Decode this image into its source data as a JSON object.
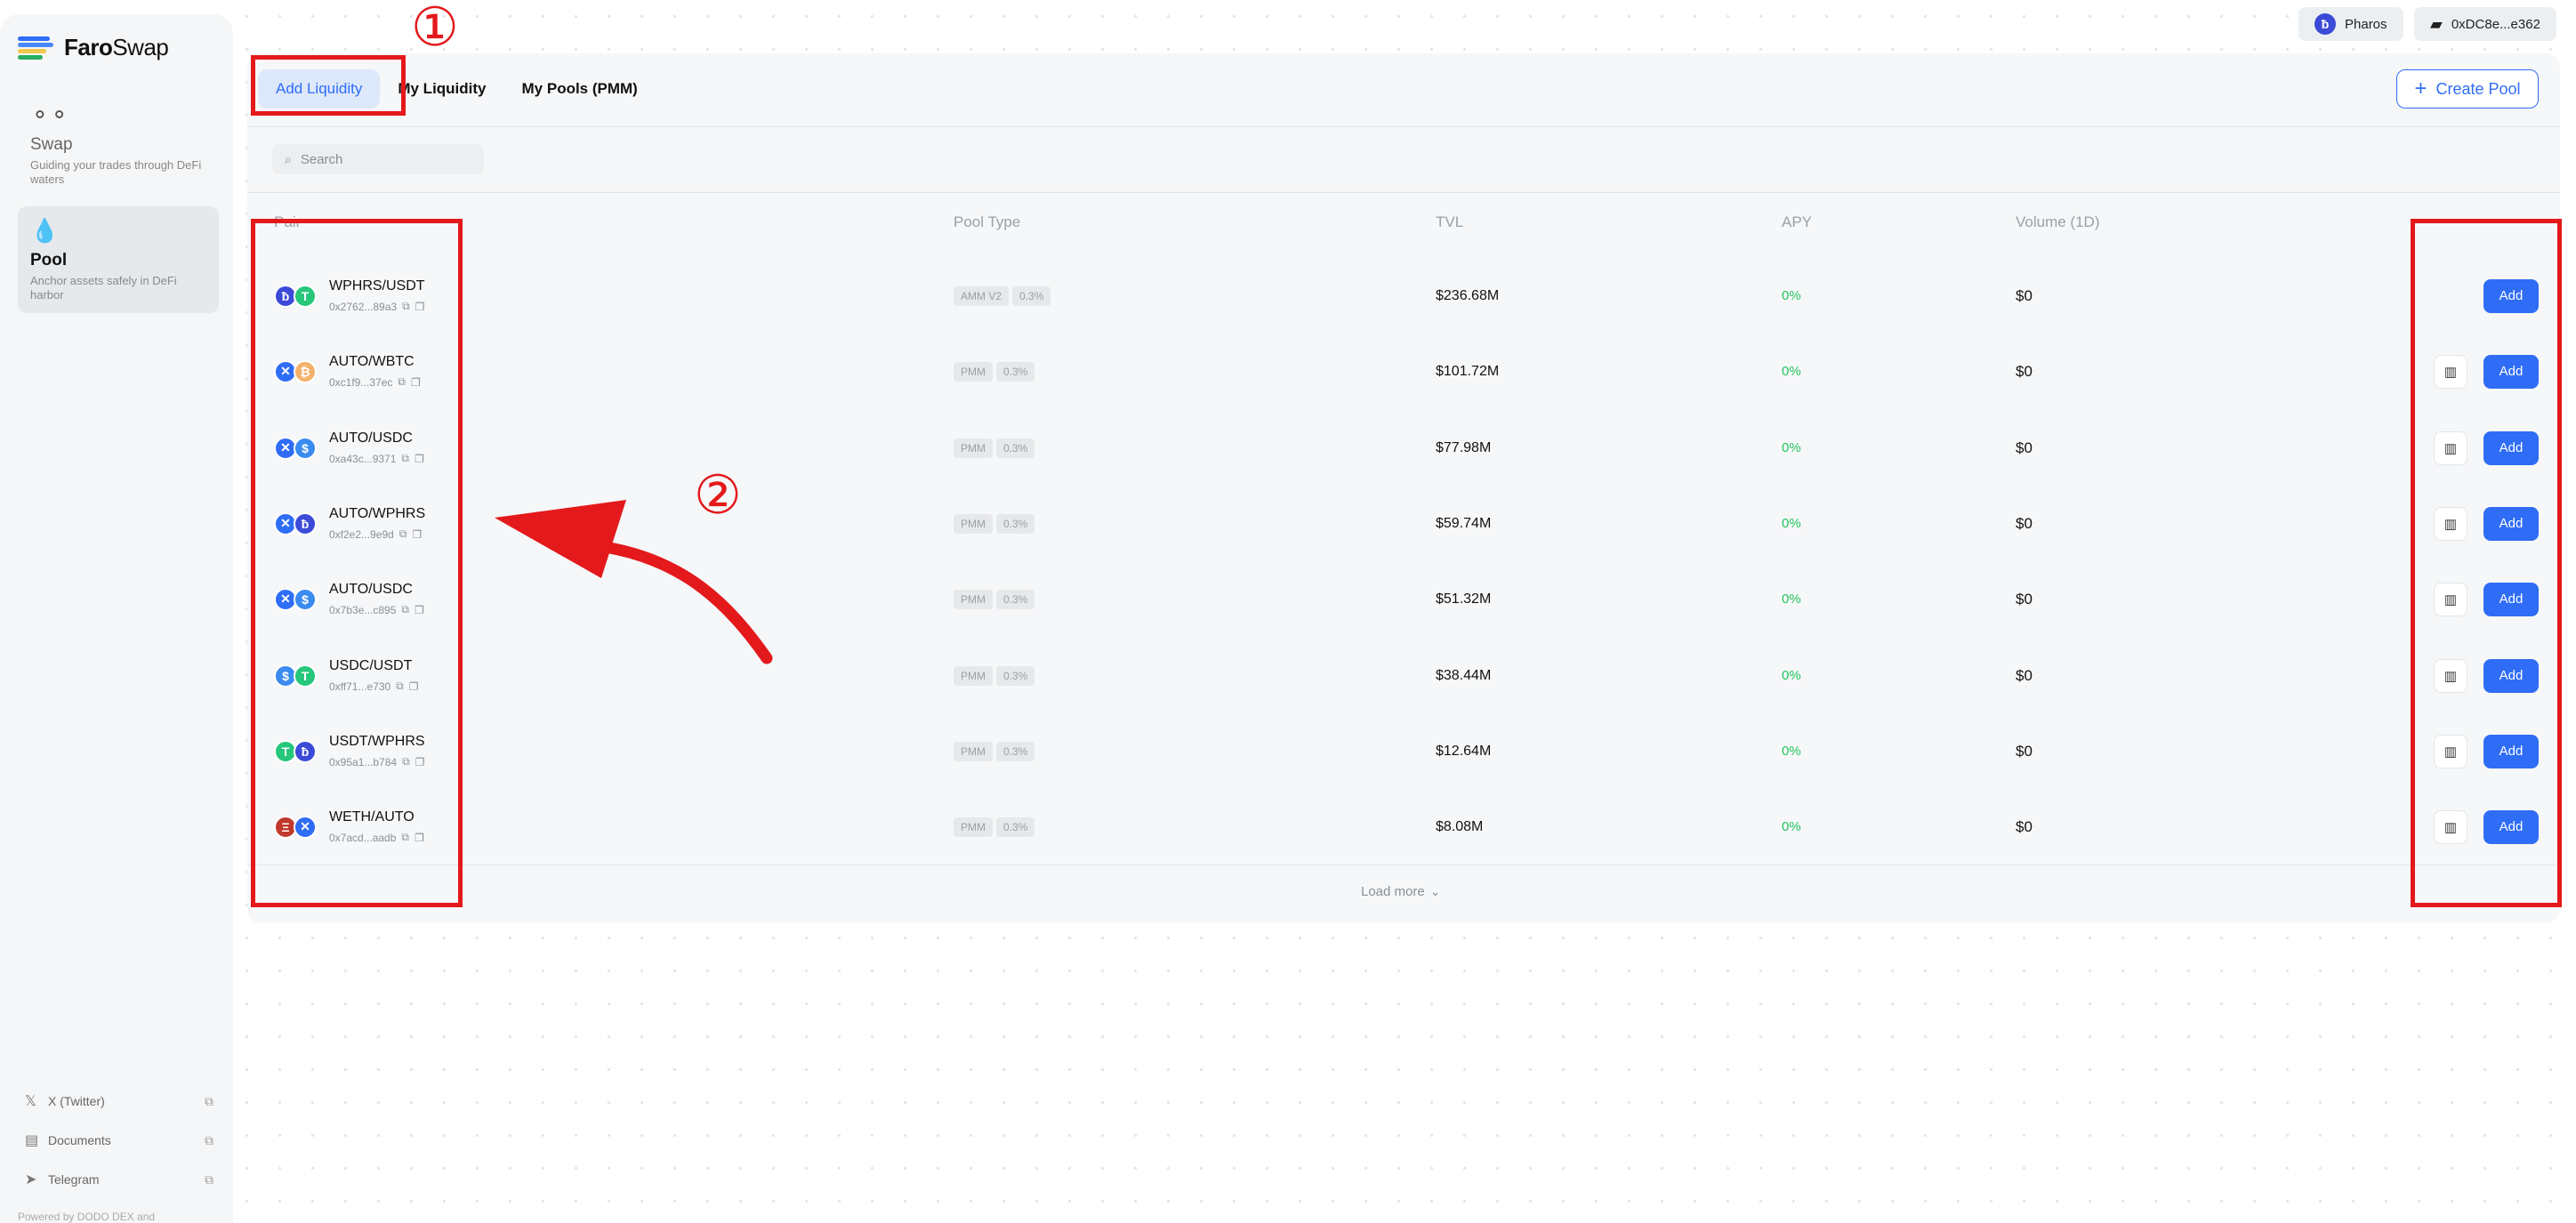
{
  "app": {
    "logo_bold": "Faro",
    "logo_rest": "Swap",
    "powered_by": "Powered by DODO DEX and"
  },
  "sidebar": {
    "items": [
      {
        "icon": "swap-icon",
        "title": "Swap",
        "desc": "Guiding your trades through DeFi waters",
        "active": false
      },
      {
        "icon": "pool-icon",
        "title": "Pool",
        "desc": "Anchor assets safely in DeFi harbor",
        "active": true
      }
    ],
    "links": [
      {
        "icon": "x-twitter-icon",
        "glyph": "𝕏",
        "label": "X (Twitter)"
      },
      {
        "icon": "documents-icon",
        "glyph": "▤",
        "label": "Documents"
      },
      {
        "icon": "telegram-icon",
        "glyph": "➤",
        "label": "Telegram"
      }
    ]
  },
  "header": {
    "network_label": "Pharos",
    "wallet_address": "0xDC8e...e362"
  },
  "tabs": [
    "Add Liquidity",
    "My Liquidity",
    "My Pools (PMM)"
  ],
  "create_pool_label": "Create Pool",
  "search_placeholder": "Search",
  "columns": {
    "pair": "Pair",
    "pool_type": "Pool Type",
    "tvl": "TVL",
    "apy": "APY",
    "volume": "Volume (1D)"
  },
  "add_label": "Add",
  "load_more_label": "Load more",
  "colors": {
    "accent": "#2f6df6",
    "apy_green": "#22c55e",
    "annotation_red": "#e3191b"
  },
  "pools": [
    {
      "pair": "WPHRS/USDT",
      "address": "0x2762...89a3",
      "type": "AMM V2",
      "fee": "0.3%",
      "tvl": "$236.68M",
      "apy": "0%",
      "volume": "$0",
      "has_chart": false,
      "tokens": [
        {
          "sym": "ƀ",
          "color": "#3b4bd8"
        },
        {
          "sym": "T",
          "color": "#26c77b"
        }
      ]
    },
    {
      "pair": "AUTO/WBTC",
      "address": "0xc1f9...37ec",
      "type": "PMM",
      "fee": "0.3%",
      "tvl": "$101.72M",
      "apy": "0%",
      "volume": "$0",
      "has_chart": true,
      "tokens": [
        {
          "sym": "✕",
          "color": "#2f6df6"
        },
        {
          "sym": "₿",
          "color": "#f3b26b"
        }
      ]
    },
    {
      "pair": "AUTO/USDC",
      "address": "0xa43c...9371",
      "type": "PMM",
      "fee": "0.3%",
      "tvl": "$77.98M",
      "apy": "0%",
      "volume": "$0",
      "has_chart": true,
      "tokens": [
        {
          "sym": "✕",
          "color": "#2f6df6"
        },
        {
          "sym": "$",
          "color": "#3a8bf0"
        }
      ]
    },
    {
      "pair": "AUTO/WPHRS",
      "address": "0xf2e2...9e9d",
      "type": "PMM",
      "fee": "0.3%",
      "tvl": "$59.74M",
      "apy": "0%",
      "volume": "$0",
      "has_chart": true,
      "tokens": [
        {
          "sym": "✕",
          "color": "#2f6df6"
        },
        {
          "sym": "ƀ",
          "color": "#3b4bd8"
        }
      ]
    },
    {
      "pair": "AUTO/USDC",
      "address": "0x7b3e...c895",
      "type": "PMM",
      "fee": "0.3%",
      "tvl": "$51.32M",
      "apy": "0%",
      "volume": "$0",
      "has_chart": true,
      "tokens": [
        {
          "sym": "✕",
          "color": "#2f6df6"
        },
        {
          "sym": "$",
          "color": "#3a8bf0"
        }
      ]
    },
    {
      "pair": "USDC/USDT",
      "address": "0xff71...e730",
      "type": "PMM",
      "fee": "0.3%",
      "tvl": "$38.44M",
      "apy": "0%",
      "volume": "$0",
      "has_chart": true,
      "tokens": [
        {
          "sym": "$",
          "color": "#3a8bf0"
        },
        {
          "sym": "T",
          "color": "#26c77b"
        }
      ]
    },
    {
      "pair": "USDT/WPHRS",
      "address": "0x95a1...b784",
      "type": "PMM",
      "fee": "0.3%",
      "tvl": "$12.64M",
      "apy": "0%",
      "volume": "$0",
      "has_chart": true,
      "tokens": [
        {
          "sym": "T",
          "color": "#26c77b"
        },
        {
          "sym": "ƀ",
          "color": "#3b4bd8"
        }
      ]
    },
    {
      "pair": "WETH/AUTO",
      "address": "0x7acd...aadb",
      "type": "PMM",
      "fee": "0.3%",
      "tvl": "$8.08M",
      "apy": "0%",
      "volume": "$0",
      "has_chart": true,
      "tokens": [
        {
          "sym": "Ξ",
          "color": "#c0392b"
        },
        {
          "sym": "✕",
          "color": "#2f6df6"
        }
      ]
    }
  ],
  "annotations": [
    "①",
    "②"
  ]
}
